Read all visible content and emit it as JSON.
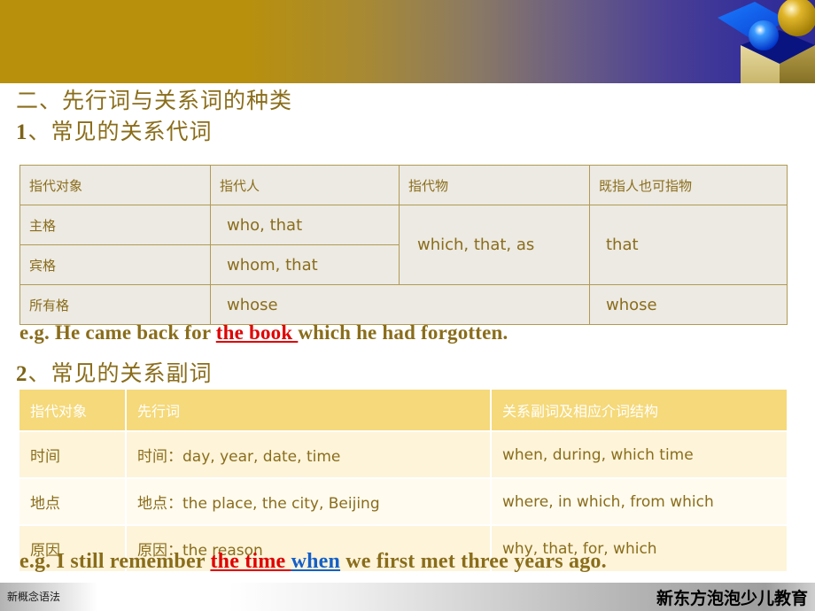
{
  "slide": {
    "heading_main": "二、先行词与关系词的种类",
    "heading_sub1_num": "1",
    "heading_sub1_text": "、常见的关系代词",
    "heading_sub2_num": "2",
    "heading_sub2_text": "、常见的关系副词"
  },
  "logo": {
    "name": "open-box-with-spheres-logo",
    "box_color": "#c9b45e",
    "lid_color": "#1469e8",
    "sphere_gold": "#c39b0a",
    "sphere_blue": "#0a66f0"
  },
  "theme": {
    "banner_gold": "#b8900c",
    "banner_indigo": "#35309a",
    "text_gold": "#8a6d1b",
    "table1_bg": "#edeae3",
    "table1_border": "#b09a54",
    "table2_header_bg": "#f5d97a",
    "table2_row_odd": "#fdf4da",
    "table2_row_even": "#fffbef",
    "highlight_red": "#e00000",
    "highlight_blue": "#1560c8"
  },
  "table_pronouns": {
    "headers": [
      "指代对象",
      "指代人",
      "指代物",
      "既指人也可指物"
    ],
    "rows": [
      {
        "label": "主格",
        "person": "who, that",
        "thing": "which, that, as",
        "both": "that"
      },
      {
        "label": "宾格",
        "person": "whom, that",
        "thing": "",
        "both": ""
      },
      {
        "label": "所有格",
        "person": "whose",
        "thing": "",
        "both": "whose"
      }
    ]
  },
  "example1": {
    "prefix": "e.g.  He came back for ",
    "highlight": "the book ",
    "suffix": "which he had forgotten."
  },
  "table_adverbs": {
    "headers": [
      "指代对象",
      "先行词",
      "关系副词及相应介词结构"
    ],
    "rows": [
      {
        "subject": "时间",
        "antecedent": "时间：day, year, date, time",
        "adverbs": "when, during, which time"
      },
      {
        "subject": "地点",
        "antecedent": "地点：the place, the city, Beijing",
        "adverbs": "where, in which, from which"
      },
      {
        "subject": "原因",
        "antecedent": "原因：the reason",
        "adverbs": "why, that, for, which"
      }
    ]
  },
  "example2": {
    "prefix": "e.g.  I still remember  ",
    "highlight_red": "the time ",
    "highlight_blue": "when",
    "suffix": " we first met three years ago."
  },
  "footer": {
    "left_label": "新概念语法",
    "right_label": "新东方泡泡少儿教育"
  }
}
